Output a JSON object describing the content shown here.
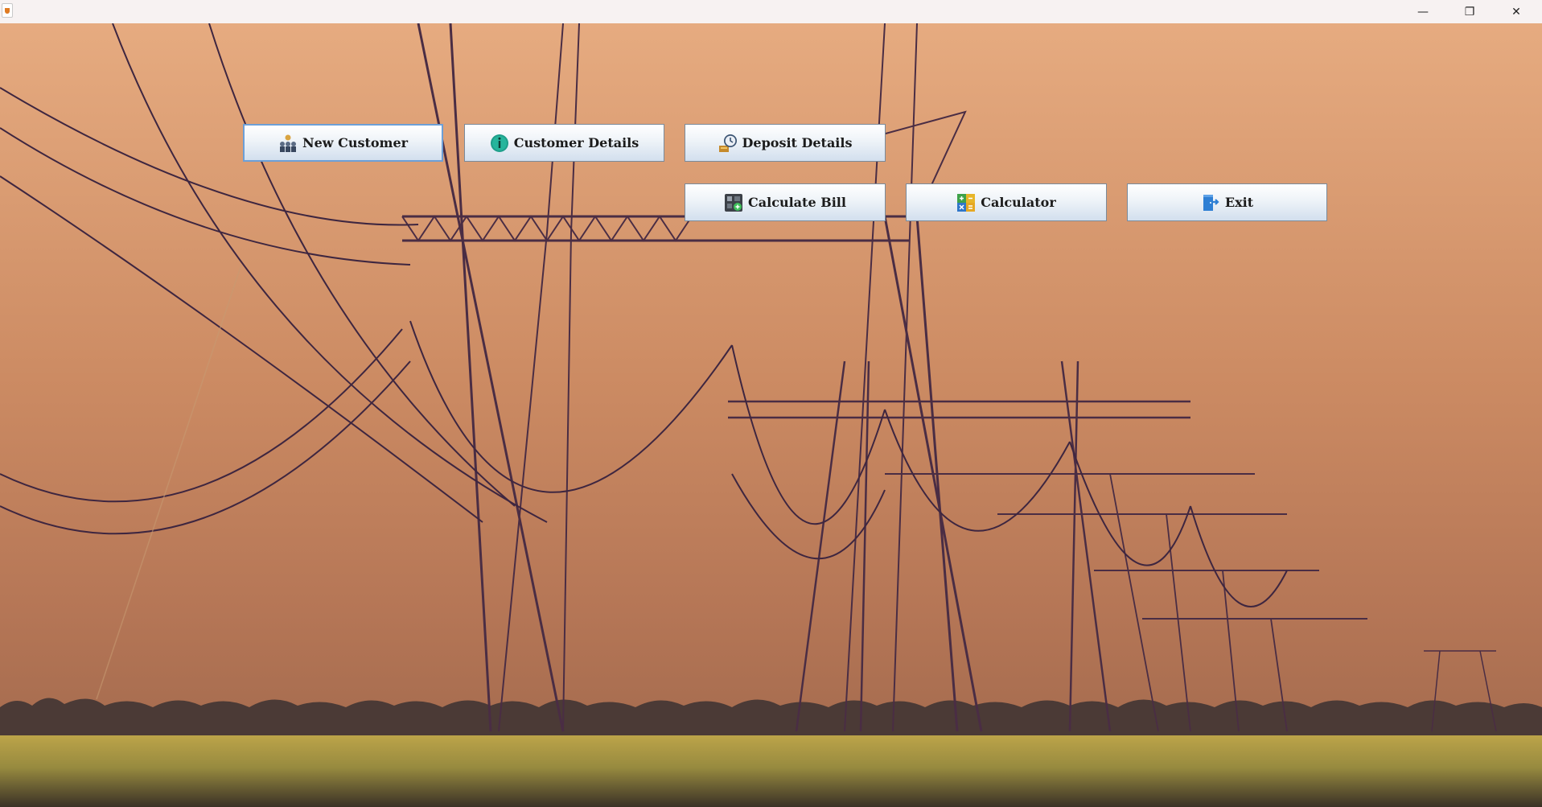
{
  "window": {
    "minimize_glyph": "—",
    "maximize_glyph": "❐",
    "close_glyph": "✕"
  },
  "menu": {
    "new_customer": "New Customer",
    "customer_details": "Customer Details",
    "deposit_details": "Deposit Details",
    "calculate_bill": "Calculate Bill",
    "calculator": "Calculator",
    "exit": "Exit"
  },
  "icons": {
    "new_customer": "people-group-icon",
    "customer_details": "info-icon",
    "deposit_details": "clock-deposit-icon",
    "calculate_bill": "bill-calculator-icon",
    "calculator": "calculator-icon",
    "exit": "exit-door-icon"
  },
  "colors": {
    "sky": "#e2a478",
    "field": "#b09b4a",
    "tower": "#4b2e45",
    "button_top": "#ffffff",
    "button_bottom": "#d2dfee",
    "focus_border": "#6d9fd6"
  }
}
